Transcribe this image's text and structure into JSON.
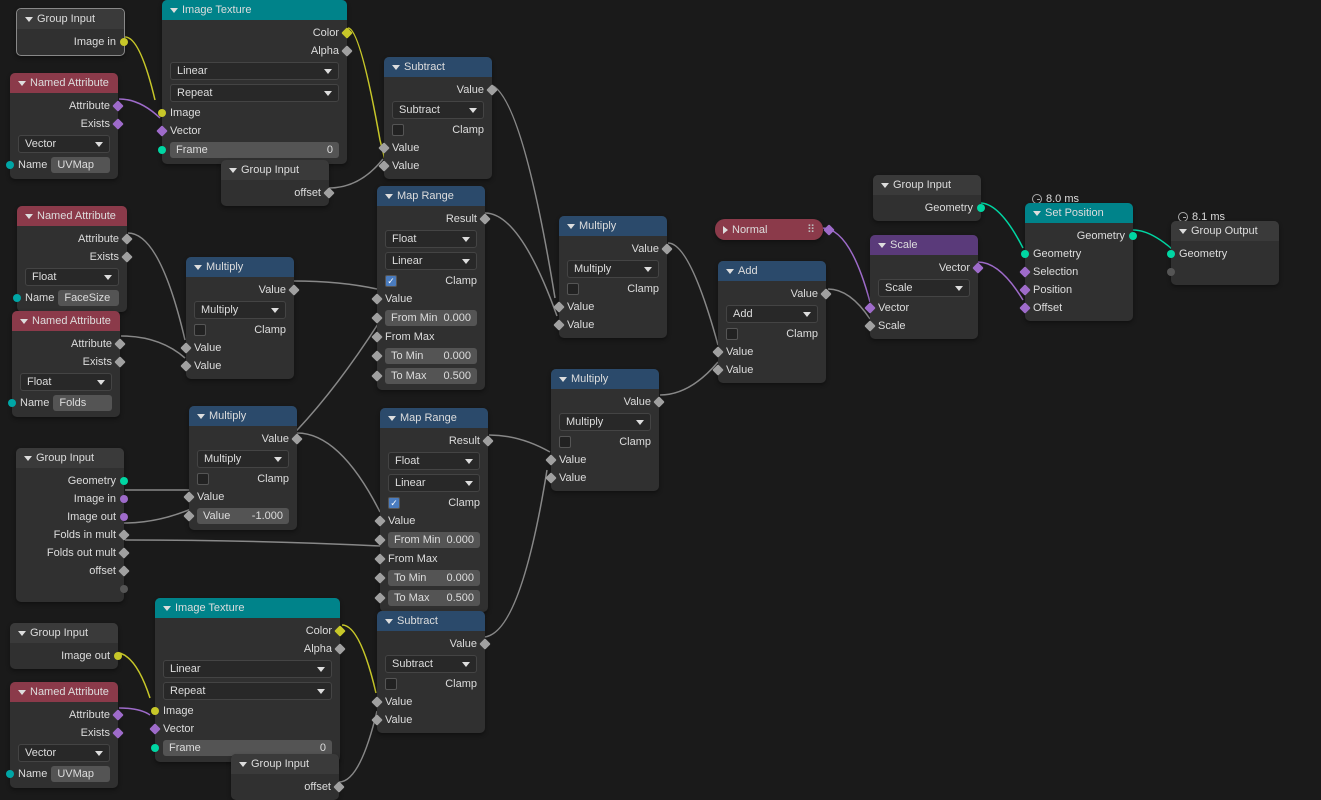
{
  "nodes": {
    "gi1": {
      "title": "Group Input",
      "outs": [
        "Image in"
      ]
    },
    "na_uv1": {
      "title": "Named Attribute",
      "outs": [
        "Attribute",
        "Exists"
      ],
      "type": "Vector",
      "name_lbl": "Name",
      "name_val": "UVMap"
    },
    "na_face": {
      "title": "Named Attribute",
      "outs": [
        "Attribute",
        "Exists"
      ],
      "type": "Float",
      "name_lbl": "Name",
      "name_val": "FaceSize"
    },
    "na_folds": {
      "title": "Named Attribute",
      "outs": [
        "Attribute",
        "Exists"
      ],
      "type": "Float",
      "name_lbl": "Name",
      "name_val": "Folds"
    },
    "gi2": {
      "title": "Group Input",
      "outs": [
        "Geometry",
        "Image in",
        "Image out",
        "Folds in mult",
        "Folds out mult",
        "offset"
      ]
    },
    "gi3": {
      "title": "Group Input",
      "outs": [
        "Image out"
      ]
    },
    "na_uv2": {
      "title": "Named Attribute",
      "outs": [
        "Attribute",
        "Exists"
      ],
      "type": "Vector",
      "name_lbl": "Name",
      "name_val": "UVMap"
    },
    "imgtex1": {
      "title": "Image Texture",
      "outs": [
        "Color",
        "Alpha"
      ],
      "interp": "Linear",
      "ext": "Repeat",
      "ins": [
        "Image",
        "Vector"
      ],
      "frame_lbl": "Frame",
      "frame_val": "0"
    },
    "gi_off1": {
      "title": "Group Input",
      "outs": [
        "offset"
      ]
    },
    "mult1": {
      "title": "Multiply",
      "out": "Value",
      "op": "Multiply",
      "clamp": "Clamp",
      "ins": [
        "Value",
        "Value"
      ]
    },
    "mult2": {
      "title": "Multiply",
      "out": "Value",
      "op": "Multiply",
      "clamp": "Clamp",
      "ins": [
        "Value"
      ],
      "val_lbl": "Value",
      "val": "-1.000"
    },
    "imgtex2": {
      "title": "Image Texture",
      "outs": [
        "Color",
        "Alpha"
      ],
      "interp": "Linear",
      "ext": "Repeat",
      "ins": [
        "Image",
        "Vector"
      ],
      "frame_lbl": "Frame",
      "frame_val": "0"
    },
    "gi_off2": {
      "title": "Group Input",
      "outs": [
        "offset"
      ]
    },
    "sub1": {
      "title": "Subtract",
      "out": "Value",
      "op": "Subtract",
      "clamp": "Clamp",
      "ins": [
        "Value",
        "Value"
      ]
    },
    "mr1": {
      "title": "Map Range",
      "out": "Result",
      "dtype": "Float",
      "itype": "Linear",
      "clamp": "Clamp",
      "ins": [
        "Value"
      ],
      "fmin_lbl": "From Min",
      "fmin": "0.000",
      "fmax": "From Max",
      "tmin_lbl": "To Min",
      "tmin": "0.000",
      "tmax_lbl": "To Max",
      "tmax": "0.500"
    },
    "mr2": {
      "title": "Map Range",
      "out": "Result",
      "dtype": "Float",
      "itype": "Linear",
      "clamp": "Clamp",
      "ins": [
        "Value"
      ],
      "fmin_lbl": "From Min",
      "fmin": "0.000",
      "fmax": "From Max",
      "tmin_lbl": "To Min",
      "tmin": "0.000",
      "tmax_lbl": "To Max",
      "tmax": "0.500"
    },
    "sub2": {
      "title": "Subtract",
      "out": "Value",
      "op": "Subtract",
      "clamp": "Clamp",
      "ins": [
        "Value",
        "Value"
      ]
    },
    "mult3": {
      "title": "Multiply",
      "out": "Value",
      "op": "Multiply",
      "clamp": "Clamp",
      "ins": [
        "Value",
        "Value"
      ]
    },
    "mult4": {
      "title": "Multiply",
      "out": "Value",
      "op": "Multiply",
      "clamp": "Clamp",
      "ins": [
        "Value",
        "Value"
      ]
    },
    "add": {
      "title": "Add",
      "out": "Value",
      "op": "Add",
      "clamp": "Clamp",
      "ins": [
        "Value",
        "Value"
      ]
    },
    "normal": {
      "title": "Normal"
    },
    "scale": {
      "title": "Scale",
      "out": "Vector",
      "op": "Scale",
      "ins": [
        "Vector",
        "Scale"
      ]
    },
    "gi4": {
      "title": "Group Input",
      "outs": [
        "Geometry"
      ]
    },
    "setpos": {
      "title": "Set Position",
      "out": "Geometry",
      "ins": [
        "Geometry",
        "Selection",
        "Position",
        "Offset"
      ]
    },
    "gout": {
      "title": "Group Output",
      "ins": [
        "Geometry"
      ]
    },
    "time1": "8.0 ms",
    "time2": "8.1 ms"
  }
}
